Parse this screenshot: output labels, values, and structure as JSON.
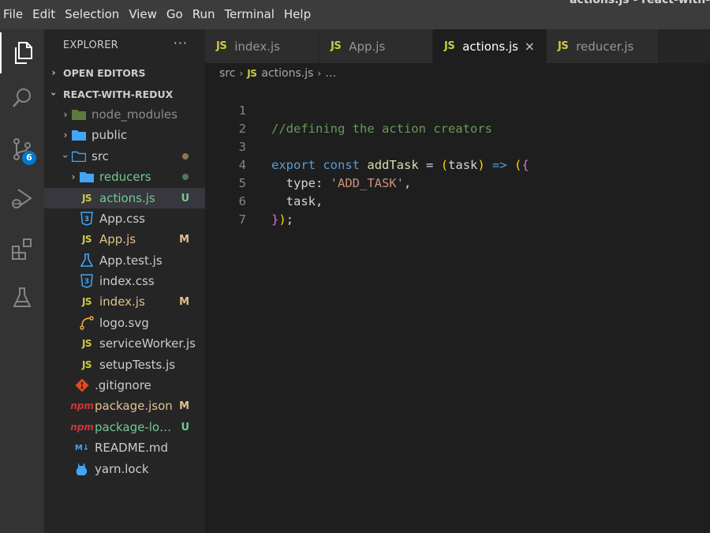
{
  "window_title": "actions.js - react-with-",
  "menu": [
    "File",
    "Edit",
    "Selection",
    "View",
    "Go",
    "Run",
    "Terminal",
    "Help"
  ],
  "activity": {
    "source_control_badge": "6"
  },
  "explorer": {
    "title": "EXPLORER",
    "more": "···",
    "open_editors": "OPEN EDITORS",
    "project": "REACT-WITH-REDUX",
    "items": [
      {
        "name": "node_modules",
        "status": ""
      },
      {
        "name": "public",
        "status": ""
      },
      {
        "name": "src",
        "status": ""
      },
      {
        "name": "reducers",
        "status": ""
      },
      {
        "name": "actions.js",
        "status": "U"
      },
      {
        "name": "App.css",
        "status": ""
      },
      {
        "name": "App.js",
        "status": "M"
      },
      {
        "name": "App.test.js",
        "status": ""
      },
      {
        "name": "index.css",
        "status": ""
      },
      {
        "name": "index.js",
        "status": "M"
      },
      {
        "name": "logo.svg",
        "status": ""
      },
      {
        "name": "serviceWorker.js",
        "status": ""
      },
      {
        "name": "setupTests.js",
        "status": ""
      },
      {
        "name": ".gitignore",
        "status": ""
      },
      {
        "name": "package.json",
        "status": "M"
      },
      {
        "name": "package-loc...",
        "status": "U"
      },
      {
        "name": "README.md",
        "status": ""
      },
      {
        "name": "yarn.lock",
        "status": ""
      }
    ]
  },
  "tabs": [
    {
      "icon": "JS",
      "label": "index.js"
    },
    {
      "icon": "JS",
      "label": "App.js"
    },
    {
      "icon": "JS",
      "label": "actions.js",
      "close": "×"
    },
    {
      "icon": "JS",
      "label": "reducer.js"
    }
  ],
  "breadcrumb": {
    "folder": "src",
    "sep": "›",
    "icon": "JS",
    "file": "actions.js",
    "rest": "…"
  },
  "code": {
    "line_numbers": [
      "1",
      "2",
      "3",
      "4",
      "5",
      "6",
      "7"
    ],
    "l1": "//defining the action creators",
    "l3_kw1": "export",
    "l3_kw2": "const",
    "l3_fn": "addTask",
    "l3_eq": " = ",
    "l3_p1": "(",
    "l3_arg": "task",
    "l3_p2": ")",
    "l3_arrow": " => ",
    "l3_p3": "(",
    "l3_b1": "{",
    "l4_prop": "  type: ",
    "l4_str": "'ADD_TASK'",
    "l4_comma": ",",
    "l5": "  task,",
    "l6_b": "}",
    "l6_p": ")",
    "l6_semi": ";"
  },
  "colors": {
    "modified": "#e2c08d",
    "untracked": "#73c991",
    "folder_blue": "#42a5f5"
  }
}
